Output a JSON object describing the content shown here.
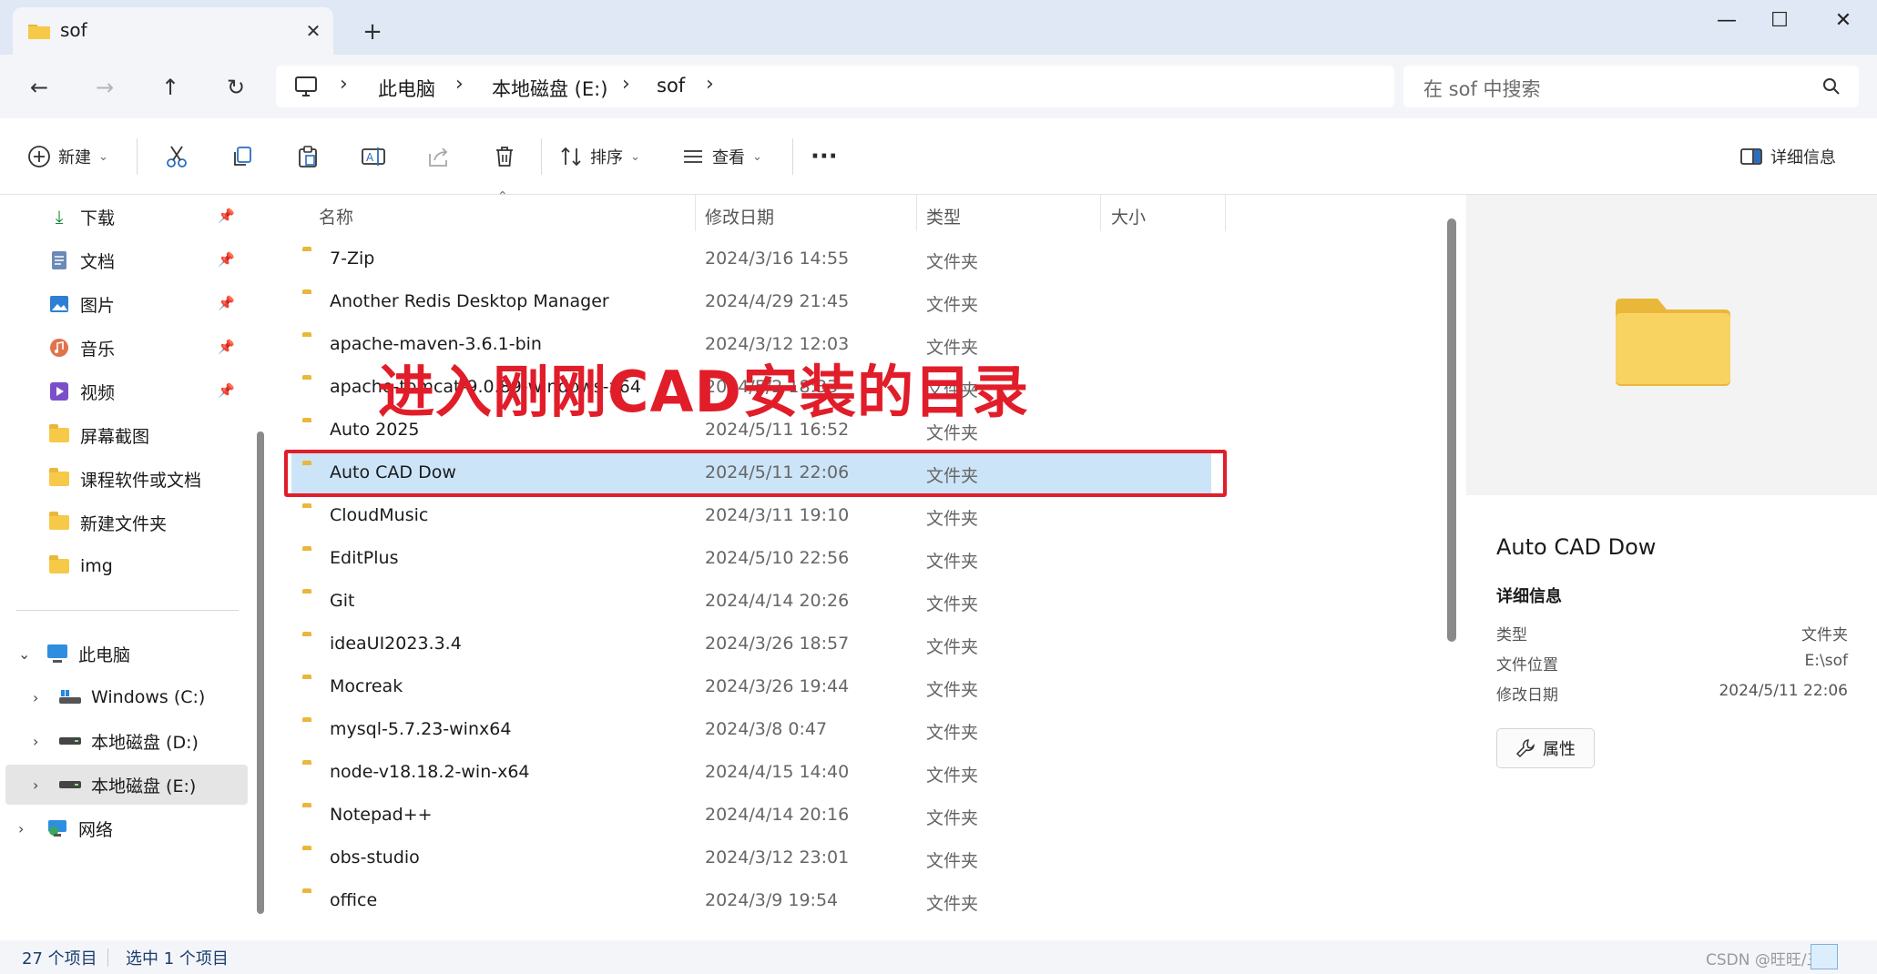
{
  "window": {
    "tab_title": "sof",
    "new_tab": "+",
    "minimize": "—",
    "maximize": "☐",
    "close": "✕"
  },
  "nav": {
    "breadcrumb": [
      "此电脑",
      "本地磁盘 (E:)",
      "sof"
    ],
    "search_placeholder": "在 sof 中搜索"
  },
  "toolbar": {
    "new_label": "新建",
    "sort_label": "排序",
    "view_label": "查看",
    "more_label": "···",
    "details_label": "详细信息"
  },
  "sidebar": {
    "quick_access": [
      {
        "label": "下载",
        "icon": "download-icon",
        "pinned": true
      },
      {
        "label": "文档",
        "icon": "document-icon",
        "pinned": true
      },
      {
        "label": "图片",
        "icon": "picture-icon",
        "pinned": true
      },
      {
        "label": "音乐",
        "icon": "music-icon",
        "pinned": true
      },
      {
        "label": "视频",
        "icon": "video-icon",
        "pinned": true
      },
      {
        "label": "屏幕截图",
        "icon": "folder-icon",
        "pinned": false
      },
      {
        "label": "课程软件或文档",
        "icon": "folder-icon",
        "pinned": false
      },
      {
        "label": "新建文件夹",
        "icon": "folder-icon",
        "pinned": false
      },
      {
        "label": "img",
        "icon": "folder-icon",
        "pinned": false
      }
    ],
    "this_pc": "此电脑",
    "drives": [
      {
        "label": "Windows (C:)",
        "selected": false
      },
      {
        "label": "本地磁盘 (D:)",
        "selected": false
      },
      {
        "label": "本地磁盘 (E:)",
        "selected": true
      }
    ],
    "network": "网络"
  },
  "columns": {
    "name": "名称",
    "modified": "修改日期",
    "type": "类型",
    "size": "大小"
  },
  "files": [
    {
      "name": "7-Zip",
      "date": "2024/3/16 14:55",
      "type": "文件夹"
    },
    {
      "name": "Another Redis Desktop Manager",
      "date": "2024/4/29 21:45",
      "type": "文件夹"
    },
    {
      "name": "apache-maven-3.6.1-bin",
      "date": "2024/3/12 12:03",
      "type": "文件夹"
    },
    {
      "name": "apache-tomcat-9.0.89-windows-x64",
      "date": "2024/5/2 18:33",
      "type": "文件夹"
    },
    {
      "name": "Auto 2025",
      "date": "2024/5/11 16:52",
      "type": "文件夹"
    },
    {
      "name": "Auto CAD Dow",
      "date": "2024/5/11 22:06",
      "type": "文件夹",
      "selected": true
    },
    {
      "name": "CloudMusic",
      "date": "2024/3/11 19:10",
      "type": "文件夹"
    },
    {
      "name": "EditPlus",
      "date": "2024/5/10 22:56",
      "type": "文件夹"
    },
    {
      "name": "Git",
      "date": "2024/4/14 20:26",
      "type": "文件夹"
    },
    {
      "name": "ideaUI2023.3.4",
      "date": "2024/3/26 18:57",
      "type": "文件夹"
    },
    {
      "name": "Mocreak",
      "date": "2024/3/26 19:44",
      "type": "文件夹"
    },
    {
      "name": "mysql-5.7.23-winx64",
      "date": "2024/3/8 0:47",
      "type": "文件夹"
    },
    {
      "name": "node-v18.18.2-win-x64",
      "date": "2024/4/15 14:40",
      "type": "文件夹"
    },
    {
      "name": "Notepad++",
      "date": "2024/4/14 20:16",
      "type": "文件夹"
    },
    {
      "name": "obs-studio",
      "date": "2024/3/12 23:01",
      "type": "文件夹"
    },
    {
      "name": "office",
      "date": "2024/3/9 19:54",
      "type": "文件夹"
    }
  ],
  "details": {
    "title": "Auto CAD Dow",
    "section": "详细信息",
    "type_label": "类型",
    "type_value": "文件夹",
    "location_label": "文件位置",
    "location_value": "E:\\sof",
    "modified_label": "修改日期",
    "modified_value": "2024/5/11 22:06",
    "properties_button": "属性"
  },
  "status": {
    "item_count": "27 个项目",
    "selected": "选中 1 个项目"
  },
  "annotation": {
    "text": "进入刚刚CAD安装的目录",
    "color": "#e11d2a"
  },
  "watermark": "CSDN @旺旺/三次"
}
